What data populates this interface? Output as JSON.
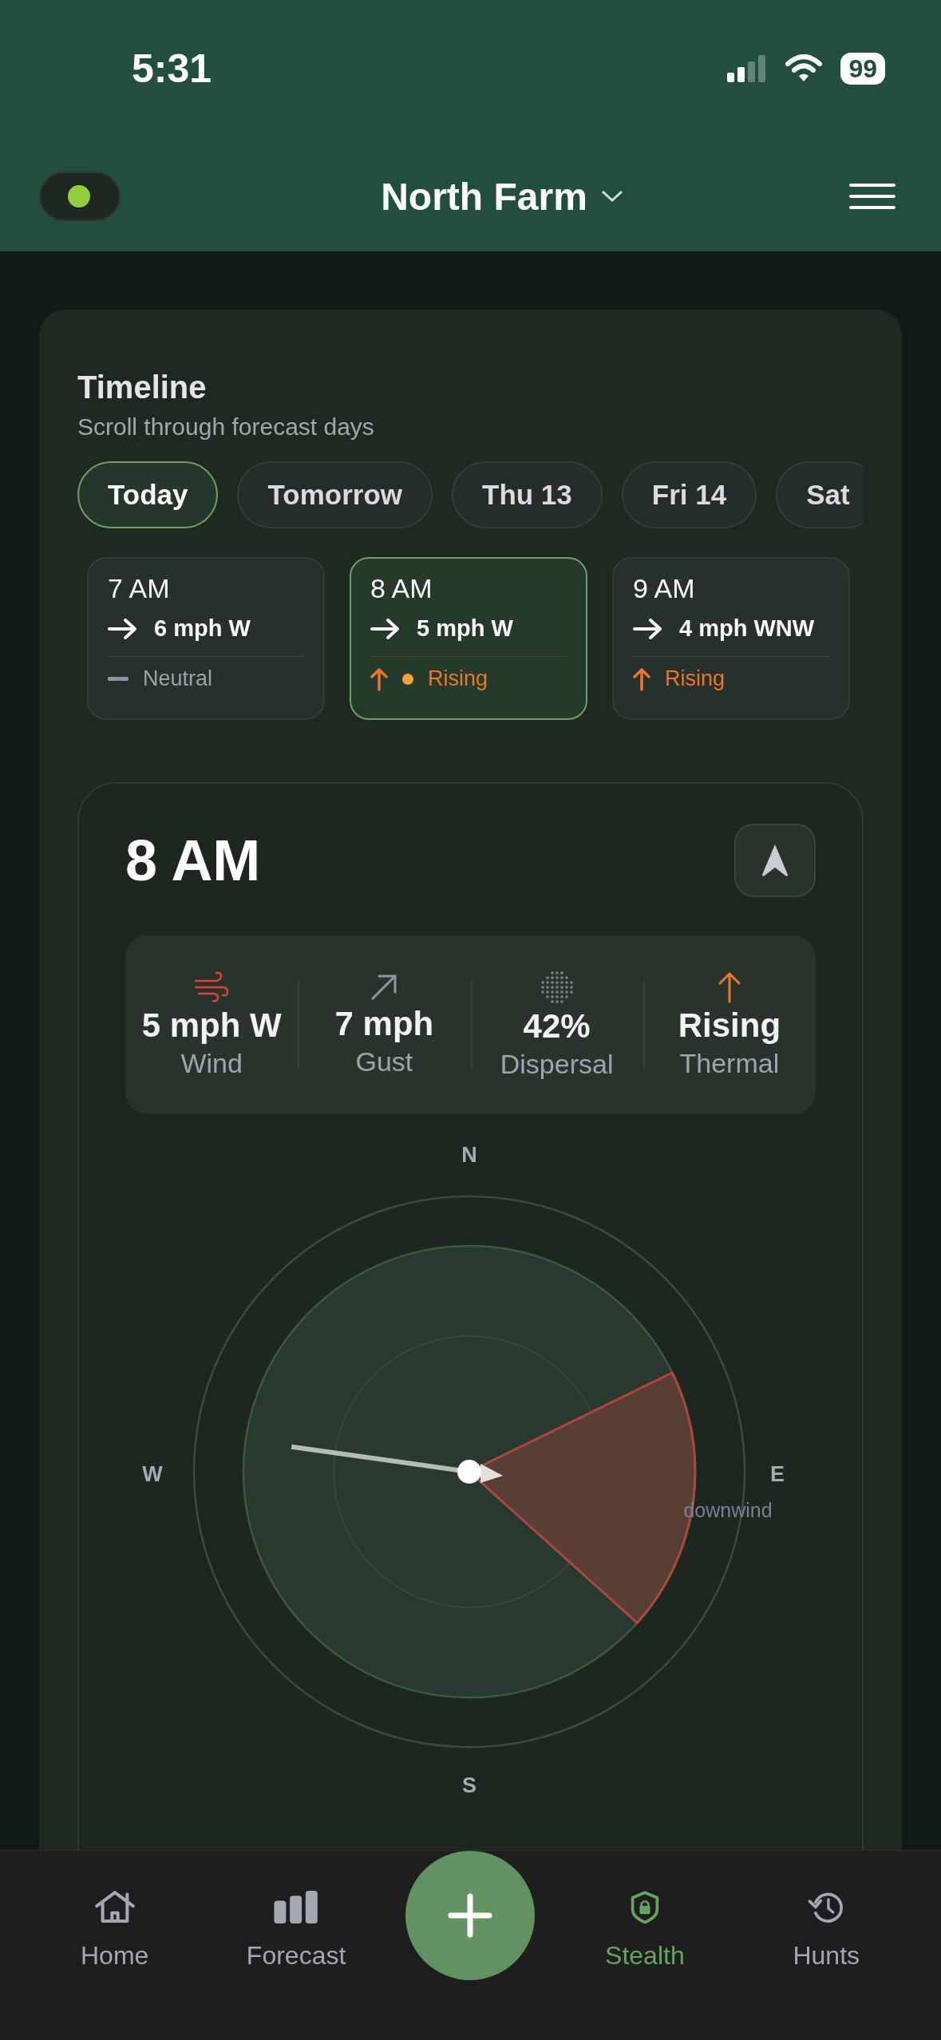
{
  "status_bar": {
    "time": "5:31",
    "battery": "99"
  },
  "header": {
    "status_on": true,
    "title": "North Farm"
  },
  "timeline": {
    "title": "Timeline",
    "subtitle": "Scroll through forecast days",
    "days": [
      {
        "label": "Today",
        "selected": true
      },
      {
        "label": "Tomorrow",
        "selected": false
      },
      {
        "label": "Thu 13",
        "selected": false
      },
      {
        "label": "Fri 14",
        "selected": false
      },
      {
        "label": "Sat",
        "selected": false
      }
    ],
    "hours": [
      {
        "time": "7 AM",
        "wind": "6 mph W",
        "thermal": "Neutral",
        "kind": "neutral",
        "selected": false,
        "current": false
      },
      {
        "time": "8 AM",
        "wind": "5 mph W",
        "thermal": "Rising",
        "kind": "rising",
        "selected": true,
        "current": true
      },
      {
        "time": "9 AM",
        "wind": "4 mph WNW",
        "thermal": "Rising",
        "kind": "rising",
        "selected": false,
        "current": false
      }
    ]
  },
  "detail": {
    "time": "8 AM",
    "metrics": [
      {
        "kind": "wind",
        "value": "5 mph W",
        "label": "Wind"
      },
      {
        "kind": "gust",
        "value": "7 mph",
        "label": "Gust"
      },
      {
        "kind": "dispersal",
        "value": "42%",
        "label": "Dispersal"
      },
      {
        "kind": "thermal",
        "value": "Rising",
        "label": "Thermal"
      }
    ],
    "compass": {
      "north": "N",
      "east": "E",
      "south": "S",
      "west": "W",
      "zone_label": "downwind"
    }
  },
  "tab_bar": {
    "items": [
      {
        "kind": "home",
        "label": "Home",
        "selected": false
      },
      {
        "kind": "forecast",
        "label": "Forecast",
        "selected": false
      },
      {
        "kind": "stealth",
        "label": "Stealth",
        "selected": true
      },
      {
        "kind": "hunts",
        "label": "Hunts",
        "selected": false
      }
    ]
  }
}
